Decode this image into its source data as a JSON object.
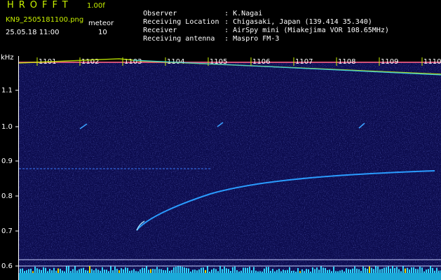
{
  "header": {
    "app_title": "HROFFT",
    "version": "1.00f",
    "filename": "KN9_2505181100.png",
    "mode": "meteor",
    "datetime": "25.05.18 11:00",
    "count": "10"
  },
  "info": [
    {
      "label": "Observer",
      "value": ": K.Nagai"
    },
    {
      "label": "Receiving Location",
      "value": ": Chigasaki, Japan (139.414 35.340)"
    },
    {
      "label": "Receiver",
      "value": ": AirSpy mini (Miakejima VOR 108.65MHz)"
    },
    {
      "label": "Receiving antenna",
      "value": ": Maspro FM-3"
    }
  ],
  "spectrogram": {
    "y_unit": "kHz",
    "y_ticks": [
      "1.1",
      "1.0",
      "0.9",
      "0.8",
      "0.7",
      "0.6"
    ],
    "time_labels": [
      "1101",
      "1102",
      "1103",
      "1104",
      "1105",
      "1106",
      "1107",
      "1108",
      "1109",
      "1110"
    ],
    "colors": {
      "background": "#0c0c4e",
      "trace": "#2a9cff",
      "marker": "#c8f000",
      "text": "#ffffff",
      "baseline": "#30e0ff"
    }
  }
}
